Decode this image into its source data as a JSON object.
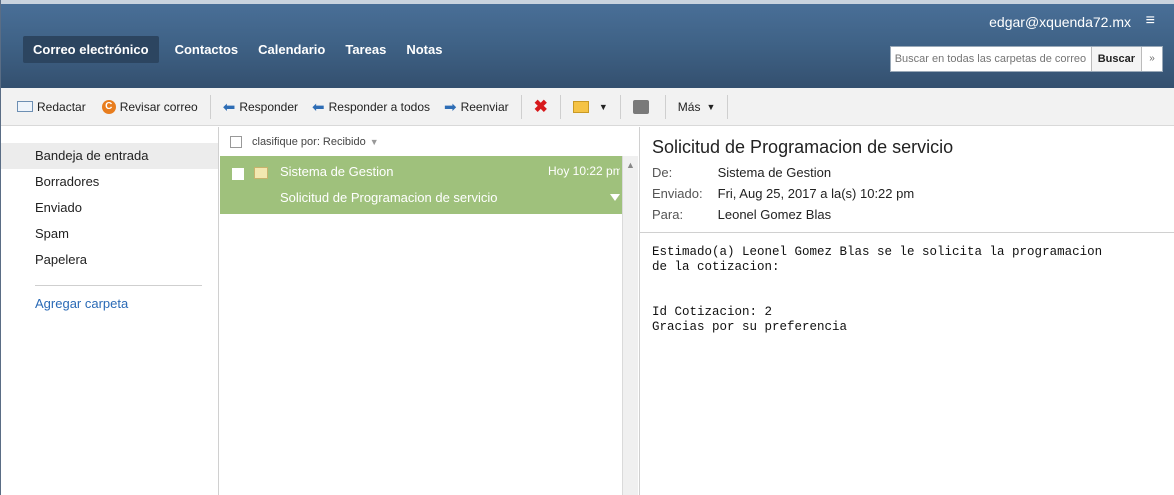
{
  "header": {
    "user_email": "edgar@xquenda72.mx",
    "menu_icon": "≡",
    "nav": [
      "Correo electrónico",
      "Contactos",
      "Calendario",
      "Tareas",
      "Notas"
    ],
    "search_placeholder": "Buscar en todas las carpetas de correo",
    "search_button": "Buscar",
    "search_chevron": "»"
  },
  "toolbar": {
    "compose": "Redactar",
    "check_mail": "Revisar correo",
    "reply": "Responder",
    "reply_all": "Responder a todos",
    "forward": "Reenviar",
    "more": "Más"
  },
  "folders": {
    "items": [
      "Bandeja de entrada",
      "Borradores",
      "Enviado",
      "Spam",
      "Papelera"
    ],
    "add_folder": "Agregar carpeta"
  },
  "message_list": {
    "sort_label": "clasifique por: Recibido",
    "messages": [
      {
        "sender": "Sistema de Gestion",
        "time": "Hoy 10:22 pm",
        "subject": "Solicitud de Programacion de servicio"
      }
    ]
  },
  "reading_pane": {
    "title": "Solicitud de Programacion de servicio",
    "from_label": "De:",
    "from": "Sistema de Gestion",
    "sent_label": "Enviado:",
    "sent": "Fri, Aug 25, 2017 a la(s) 10:22 pm",
    "to_label": "Para:",
    "to": "Leonel Gomez Blas",
    "body": "Estimado(a) Leonel Gomez Blas se le solicita la programacion\nde la cotizacion:\n\n\nId Cotizacion: 2\nGracias por su preferencia"
  },
  "colors": {
    "header_blue": "#3f6286",
    "selected_row_green": "#9fc17c",
    "link_blue": "#2a6ab6"
  }
}
